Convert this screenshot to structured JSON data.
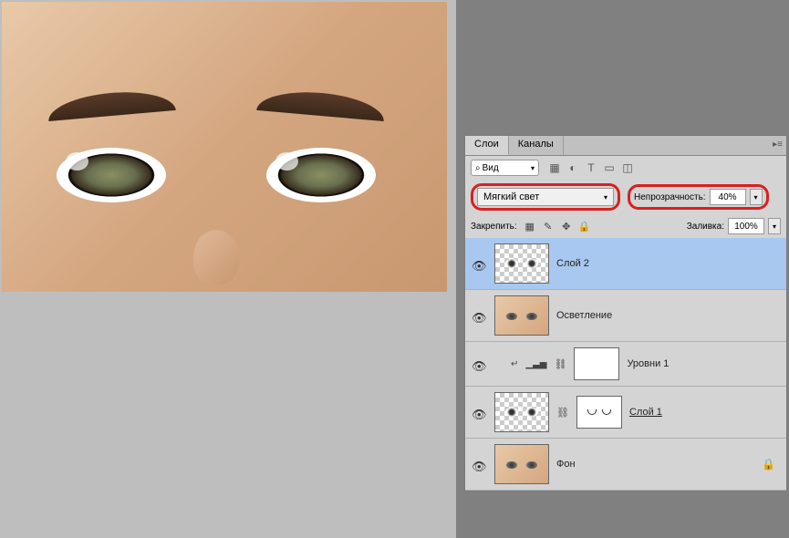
{
  "tabs": {
    "layers": "Слои",
    "channels": "Каналы"
  },
  "filter": {
    "label": "Вид"
  },
  "blend": {
    "mode": "Мягкий свет",
    "opacity_label": "Непрозрачность:",
    "opacity_value": "40%"
  },
  "lock": {
    "label": "Закрепить:",
    "fill_label": "Заливка:",
    "fill_value": "100%"
  },
  "layers": [
    {
      "name": "Слой 2"
    },
    {
      "name": "Осветление"
    },
    {
      "name": "Уровни 1"
    },
    {
      "name": "Слой 1"
    },
    {
      "name": "Фон"
    }
  ]
}
